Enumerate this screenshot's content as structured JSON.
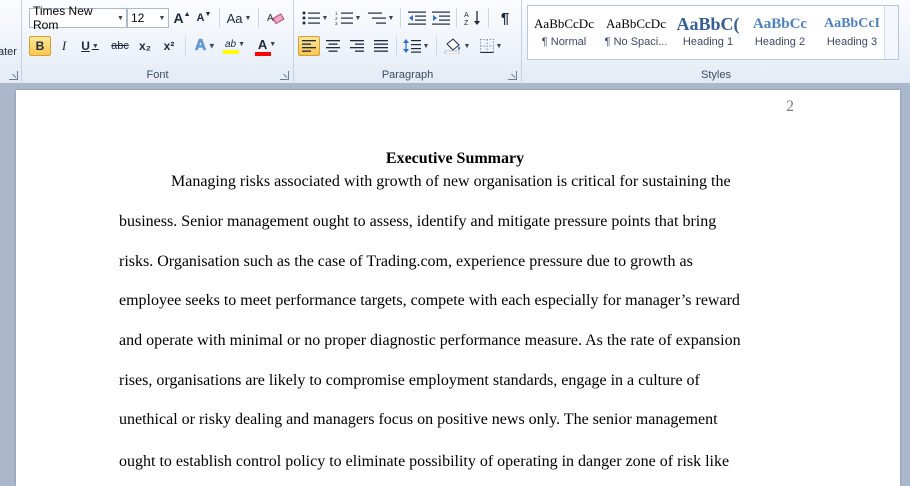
{
  "ribbon": {
    "font_group": {
      "label": "Font",
      "font_name": "Times New Rom",
      "font_size": "12",
      "grow_font": "A",
      "shrink_font": "A",
      "change_case": "Aa",
      "bold": "B",
      "italic": "I",
      "underline": "U",
      "strikethrough": "abc",
      "subscript": "x₂",
      "superscript": "x²",
      "text_effects": "A",
      "highlight": "ab",
      "font_color": "A",
      "highlight_color": "#ffff00",
      "font_color_value": "#ff0000"
    },
    "paragraph_group": {
      "label": "Paragraph"
    },
    "styles_group": {
      "label": "Styles",
      "items": [
        {
          "sample": "AaBbCcDc",
          "name": "¶ Normal"
        },
        {
          "sample": "AaBbCcDc",
          "name": "¶ No Spaci..."
        },
        {
          "sample": "AaBbC(",
          "name": "Heading 1"
        },
        {
          "sample": "AaBbCc",
          "name": "Heading 2"
        },
        {
          "sample": "AaBbCcI",
          "name": "Heading 3"
        }
      ]
    },
    "left_clip_label": "ater"
  },
  "document": {
    "page_number": "2",
    "title": "Executive Summary",
    "lines": [
      "Managing risks associated with growth of new organisation is critical for sustaining the",
      "business.  Senior management ought to assess, identify and mitigate pressure points that bring",
      "risks. Organisation such as the case of Trading.com, experience pressure due to growth as",
      "employee seeks to meet performance targets, compete with each especially for manager’s reward",
      "and operate with minimal or no proper diagnostic performance measure. As the rate of expansion",
      "rises, organisations are likely to compromise employment standards, engage in a culture of",
      "unethical or risky dealing and managers focus on positive news only. The senior management",
      "ought to establish control policy to eliminate possibility of operating in danger zone of risk like"
    ]
  }
}
